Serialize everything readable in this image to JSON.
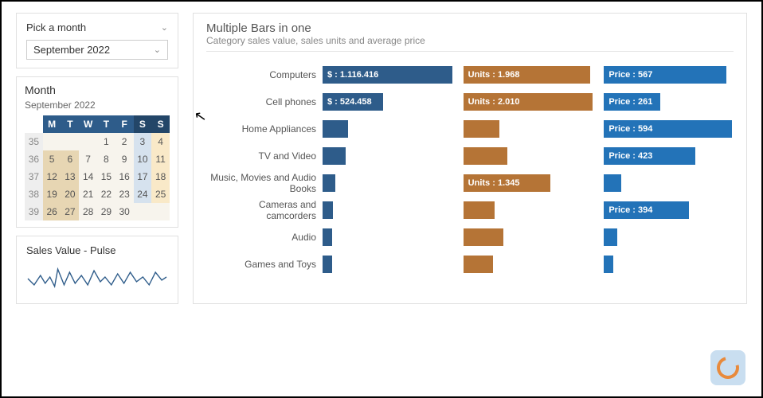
{
  "picker": {
    "title": "Pick a month",
    "selected": "September 2022"
  },
  "calendar": {
    "title": "Month",
    "subtitle": "September 2022",
    "day_headers": [
      "",
      "M",
      "T",
      "W",
      "T",
      "F",
      "S",
      "S"
    ],
    "rows": [
      {
        "wk": "35",
        "cells": [
          {
            "v": "",
            "t": "out"
          },
          {
            "v": "",
            "t": "out"
          },
          {
            "v": "",
            "t": "out"
          },
          {
            "v": "1",
            "t": "day"
          },
          {
            "v": "2",
            "t": "day"
          },
          {
            "v": "3",
            "t": "sat"
          },
          {
            "v": "4",
            "t": "sun"
          }
        ]
      },
      {
        "wk": "36",
        "cells": [
          {
            "v": "5",
            "t": "hl"
          },
          {
            "v": "6",
            "t": "hl"
          },
          {
            "v": "7",
            "t": "day"
          },
          {
            "v": "8",
            "t": "day"
          },
          {
            "v": "9",
            "t": "day"
          },
          {
            "v": "10",
            "t": "sat"
          },
          {
            "v": "11",
            "t": "sun"
          }
        ]
      },
      {
        "wk": "37",
        "cells": [
          {
            "v": "12",
            "t": "hl"
          },
          {
            "v": "13",
            "t": "hl"
          },
          {
            "v": "14",
            "t": "day"
          },
          {
            "v": "15",
            "t": "day"
          },
          {
            "v": "16",
            "t": "day"
          },
          {
            "v": "17",
            "t": "sat"
          },
          {
            "v": "18",
            "t": "sun"
          }
        ]
      },
      {
        "wk": "38",
        "cells": [
          {
            "v": "19",
            "t": "hl"
          },
          {
            "v": "20",
            "t": "hl"
          },
          {
            "v": "21",
            "t": "day"
          },
          {
            "v": "22",
            "t": "day"
          },
          {
            "v": "23",
            "t": "day"
          },
          {
            "v": "24",
            "t": "sat"
          },
          {
            "v": "25",
            "t": "sun"
          }
        ]
      },
      {
        "wk": "39",
        "cells": [
          {
            "v": "26",
            "t": "hl"
          },
          {
            "v": "27",
            "t": "hl"
          },
          {
            "v": "28",
            "t": "day"
          },
          {
            "v": "29",
            "t": "day"
          },
          {
            "v": "30",
            "t": "day"
          },
          {
            "v": "",
            "t": "out"
          },
          {
            "v": "",
            "t": "out"
          }
        ]
      }
    ]
  },
  "pulse": {
    "title": "Sales Value - Pulse"
  },
  "chart_header": {
    "title": "Multiple Bars in one",
    "subtitle": "Category sales value, sales units and average price"
  },
  "chart_data": {
    "type": "bar",
    "orientation": "horizontal",
    "grouped": true,
    "categories": [
      "Computers",
      "Cell phones",
      "Home Appliances",
      "TV and Video",
      "Music, Movies and Audio Books",
      "Cameras and camcorders",
      "Audio",
      "Games and Toys"
    ],
    "series": [
      {
        "name": "Sales Value ($)",
        "color": "#2e5c8a",
        "values": [
          1116416,
          524458,
          220000,
          200000,
          110000,
          90000,
          40000,
          30000
        ],
        "labels": [
          "$ : 1.116.416",
          "$ : 524.458",
          "",
          "",
          "",
          "",
          "",
          ""
        ]
      },
      {
        "name": "Sales Units",
        "color": "#b57436",
        "values": [
          1968,
          2010,
          560,
          680,
          1345,
          490,
          620,
          460
        ],
        "labels": [
          "Units : 1.968",
          "Units : 2.010",
          "",
          "",
          "Units : 1.345",
          "",
          "",
          ""
        ]
      },
      {
        "name": "Average Price",
        "color": "#2373b8",
        "values": [
          567,
          261,
          594,
          423,
          80,
          394,
          60,
          20
        ],
        "labels": [
          "Price : 567",
          "Price : 261",
          "Price : 594",
          "Price : 423",
          "",
          "Price : 394",
          "",
          ""
        ]
      }
    ],
    "max": {
      "value": 1116416,
      "units": 2010,
      "price": 600
    }
  }
}
